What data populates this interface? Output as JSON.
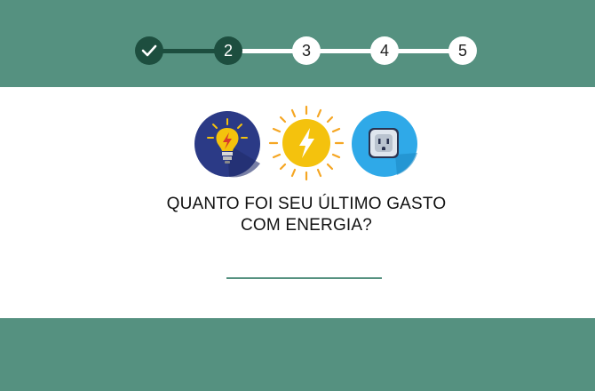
{
  "stepper": {
    "steps": [
      {
        "label": "",
        "state": "completed"
      },
      {
        "label": "2",
        "state": "current"
      },
      {
        "label": "3",
        "state": "pending"
      },
      {
        "label": "4",
        "state": "pending"
      },
      {
        "label": "5",
        "state": "pending"
      }
    ]
  },
  "icons": [
    "lightbulb-icon",
    "sun-bolt-icon",
    "power-outlet-icon"
  ],
  "question": {
    "line1": "QUANTO FOI SEU ÚLTIMO GASTO",
    "line2": "COM ENERGIA?"
  },
  "answer": {
    "value": "",
    "placeholder": ""
  },
  "colors": {
    "band": "#559180",
    "step_done": "#1d4e3f",
    "step_pending": "#ffffff"
  }
}
